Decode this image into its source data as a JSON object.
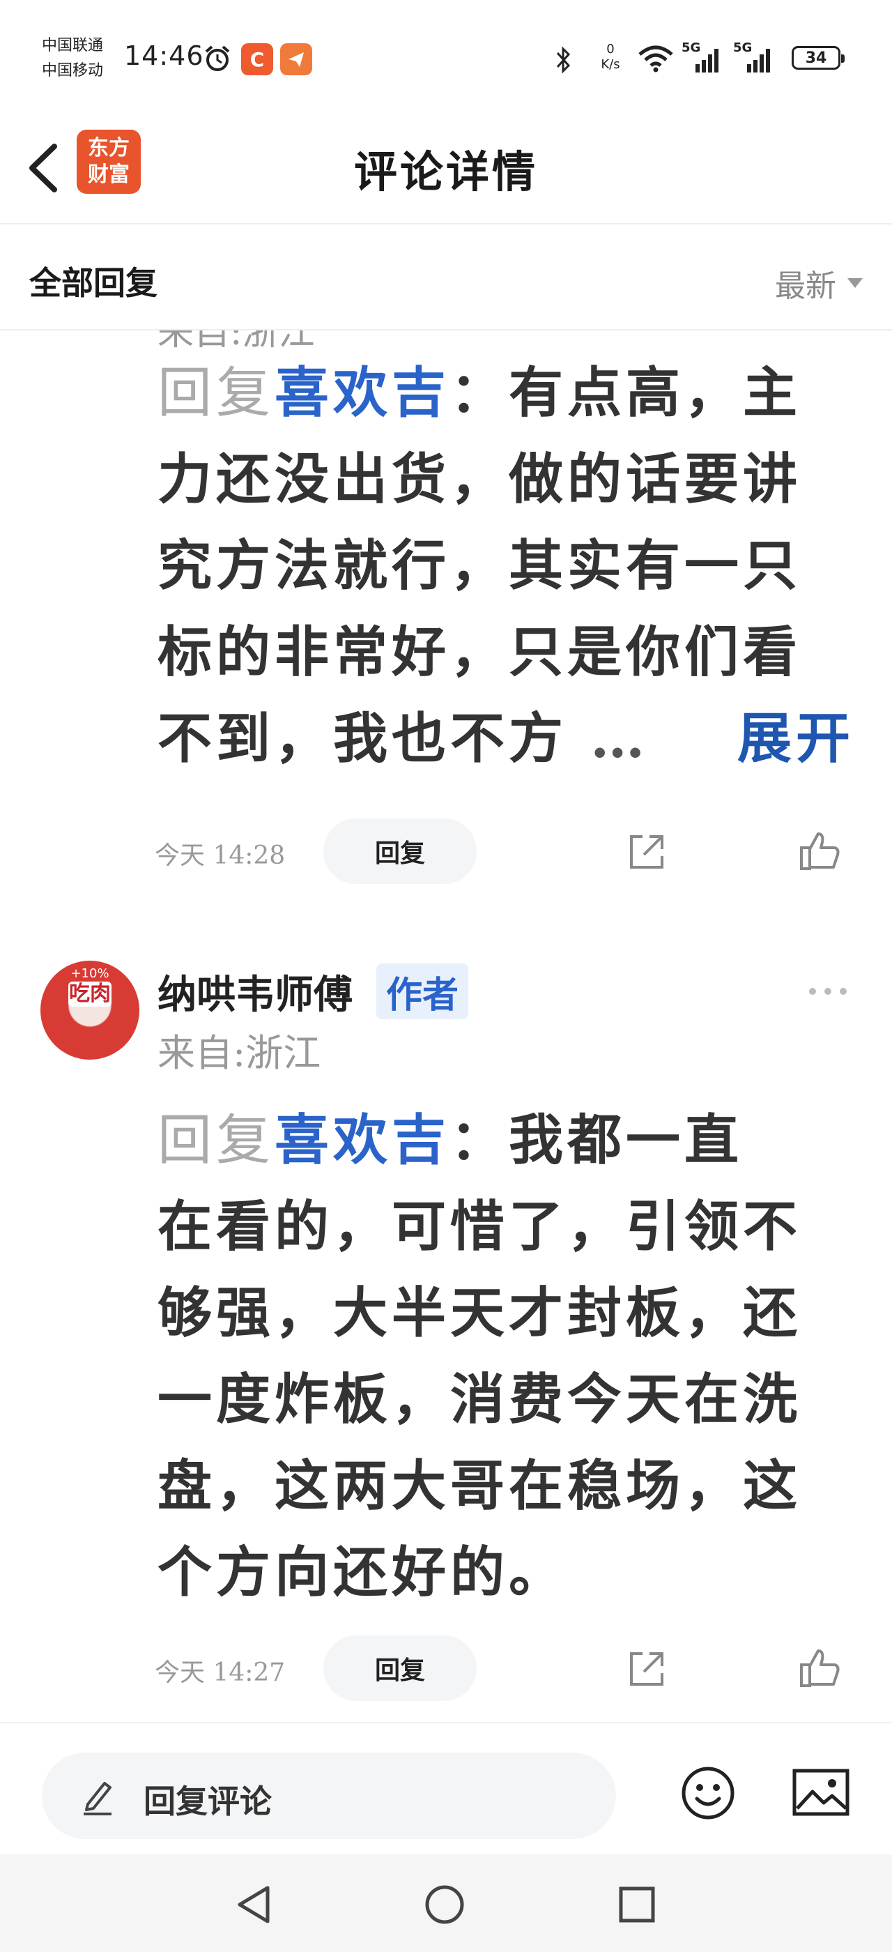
{
  "status_bar": {
    "carrier_1": "中国联通",
    "carrier_2": "中国移动",
    "time": "14:46",
    "app_badge_1": "C",
    "net_speed_value": "0",
    "net_speed_unit": "K/s",
    "signal_1_label": "5G",
    "signal_2_label": "5G",
    "battery": "34",
    "icons": [
      "alarm-icon",
      "bluetooth-icon",
      "wifi-icon",
      "signal-icon",
      "battery-icon"
    ]
  },
  "header": {
    "title": "评论详情",
    "logo_line_1": "东方",
    "logo_line_2": "财富",
    "brand_color": "#e8542b"
  },
  "section": {
    "title": "全部回复",
    "sort_label": "最新"
  },
  "comments": [
    {
      "location": "来自:浙江",
      "reply_prefix": "回复",
      "reply_target": "喜欢吉",
      "colon": "：",
      "text_line_1": "有点高，主",
      "text_line_2": "力还没出货，做的话要讲",
      "text_line_3": "究方法就行，其实有一只",
      "text_line_4": "标的非常好，只是你们看",
      "text_line_5": "不到，我也不方",
      "ellipsis": "…",
      "expand_label": "展开",
      "time": "今天 14:28",
      "reply_button": "回复"
    },
    {
      "user_name": "纳哄韦师傅",
      "author_badge": "作者",
      "avatar_text": "吃肉",
      "location": "来自:浙江",
      "reply_prefix": "回复",
      "reply_target": "喜欢吉",
      "colon": "：",
      "text_line_1": "我都一直",
      "text_line_2": "在看的，可惜了，引领不",
      "text_line_3": "够强，大半天才封板，还",
      "text_line_4": "一度炸板，消费今天在洗",
      "text_line_5": "盘，这两大哥在稳场，这",
      "text_line_6": "个方向还好的。",
      "time": "今天 14:27",
      "reply_button": "回复"
    }
  ],
  "bottom_bar": {
    "placeholder": "回复评论"
  },
  "colors": {
    "link_blue": "#2a63c9",
    "muted_gray": "#999999",
    "accent_orange": "#e8542b"
  }
}
